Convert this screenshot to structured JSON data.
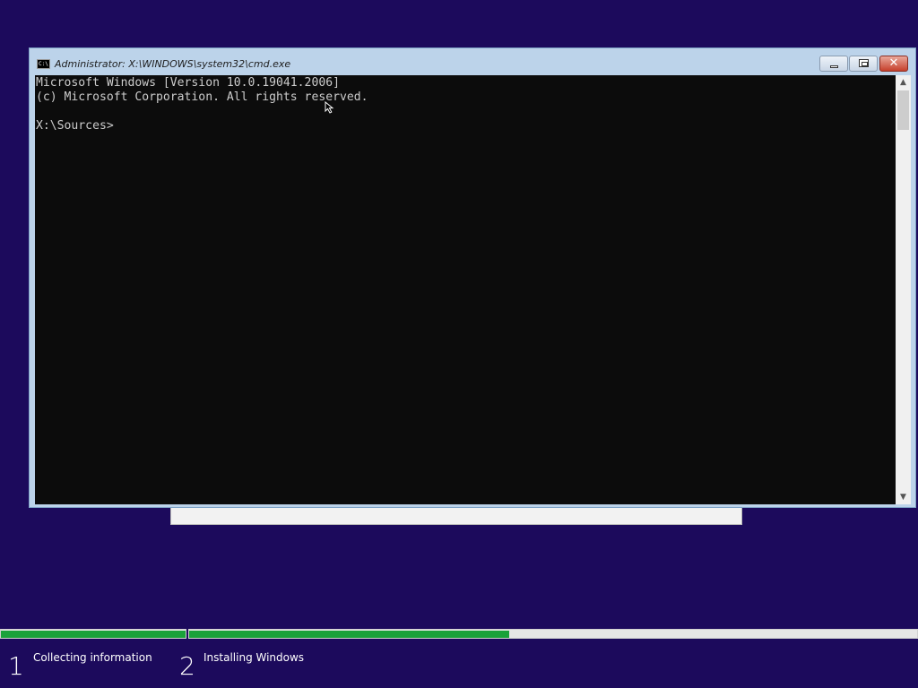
{
  "window": {
    "title": "Administrator: X:\\WINDOWS\\system32\\cmd.exe",
    "icon": "cmd-icon",
    "icon_text": "C:\\",
    "close_glyph": "✕"
  },
  "console": {
    "lines": [
      "Microsoft Windows [Version 10.0.19041.2006]",
      "(c) Microsoft Corporation. All rights reserved.",
      "",
      "X:\\Sources>"
    ],
    "background": "#0c0c0c",
    "foreground": "#cccccc"
  },
  "scrollbar": {
    "up_glyph": "▲",
    "down_glyph": "▼"
  },
  "setup": {
    "steps": [
      {
        "number": "1",
        "label": "Collecting information",
        "progress": 1.0
      },
      {
        "number": "2",
        "label": "Installing Windows",
        "progress": 0.44
      }
    ],
    "accent": "#1aa23a",
    "background": "#1c0a5c"
  }
}
